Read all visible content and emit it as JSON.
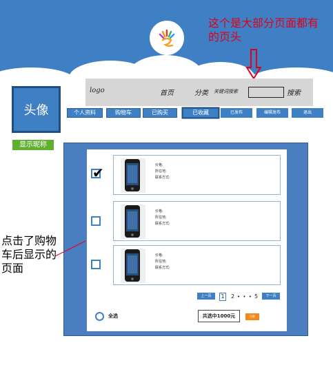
{
  "annotations": {
    "header_note": "这个是大部分页面都有的页头",
    "page_note": "点击了购物车后显示的页面"
  },
  "header_sketch": {
    "logo": "logo",
    "home": "首页",
    "category": "分类",
    "search_label": "关键词搜索",
    "search_button": "搜索"
  },
  "profile": {
    "avatar_label": "头像",
    "nickname": "显示昵称"
  },
  "nav": {
    "items": [
      {
        "label": "个人资料"
      },
      {
        "label": "购物车"
      },
      {
        "label": "已购买"
      },
      {
        "label": "已收藏"
      },
      {
        "label": "已发布"
      },
      {
        "label": "编辑发布"
      },
      {
        "label": "退出"
      }
    ]
  },
  "cart": {
    "item_fields": {
      "price": "价格:",
      "location": "所在地:",
      "contact": "联系方式:"
    },
    "items": [
      {
        "checked": true
      },
      {
        "checked": false
      },
      {
        "checked": false
      }
    ],
    "pagination": {
      "prev": "上一页",
      "current": "1",
      "page2": "2",
      "dots": "• • •",
      "last": "5",
      "next": "下一页"
    },
    "select_all": "全选",
    "total": "共选中1000元",
    "pay": "付款"
  },
  "colors": {
    "brand_blue": "#3f7fc4",
    "annotation_red": "#e0001a",
    "nickname_green": "#5fb030",
    "pay_orange": "#f08a1c"
  }
}
